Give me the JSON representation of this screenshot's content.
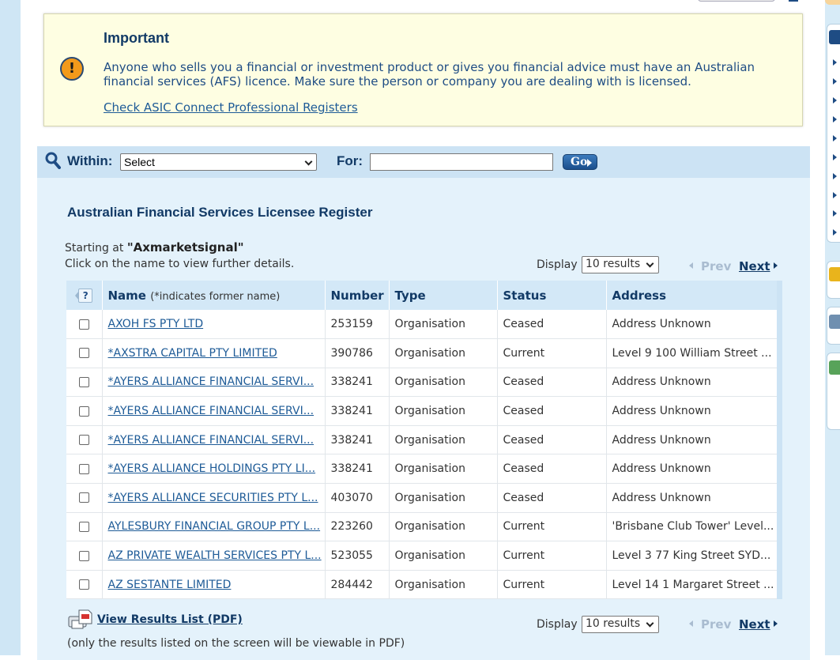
{
  "important": {
    "title": "Important",
    "icon": "exclamation-icon",
    "text": "Anyone who sells you a financial or investment product or gives you financial advice must have an Australian financial services (AFS) licence. Make sure the person or company you are dealing with is licensed.",
    "link": "Check ASIC Connect Professional Registers"
  },
  "search": {
    "within_label": "Within:",
    "within_value": "Select",
    "for_label": "For:",
    "for_value": "",
    "go_label": "Go"
  },
  "register": {
    "title": "Australian Financial Services Licensee Register",
    "starting_prefix": "Starting at ",
    "starting_value": "\"Axmarketsignal\"",
    "click_hint": "Click on the name to view further details."
  },
  "pagination": {
    "display_label": "Display",
    "display_value": "10 results",
    "prev": "Prev",
    "next": "Next"
  },
  "table": {
    "help": "?",
    "headers": {
      "name": "Name",
      "name_note": "(*indicates former name)",
      "number": "Number",
      "type": "Type",
      "status": "Status",
      "address": "Address"
    },
    "rows": [
      {
        "name": "AXOH FS PTY LTD",
        "number": "253159",
        "type": "Organisation",
        "status": "Ceased",
        "address": "Address Unknown"
      },
      {
        "name": "*AXSTRA CAPITAL PTY LIMITED",
        "number": "390786",
        "type": "Organisation",
        "status": "Current",
        "address": "Level 9 100 William Street ..."
      },
      {
        "name": "*AYERS ALLIANCE FINANCIAL SERVI...",
        "number": "338241",
        "type": "Organisation",
        "status": "Ceased",
        "address": "Address Unknown"
      },
      {
        "name": "*AYERS ALLIANCE FINANCIAL SERVI...",
        "number": "338241",
        "type": "Organisation",
        "status": "Ceased",
        "address": "Address Unknown"
      },
      {
        "name": "*AYERS ALLIANCE FINANCIAL SERVI...",
        "number": "338241",
        "type": "Organisation",
        "status": "Ceased",
        "address": "Address Unknown"
      },
      {
        "name": "*AYERS ALLIANCE HOLDINGS PTY LI...",
        "number": "338241",
        "type": "Organisation",
        "status": "Ceased",
        "address": "Address Unknown"
      },
      {
        "name": "*AYERS ALLIANCE SECURITIES PTY L...",
        "number": "403070",
        "type": "Organisation",
        "status": "Ceased",
        "address": "Address Unknown"
      },
      {
        "name": "AYLESBURY FINANCIAL GROUP PTY L...",
        "number": "223260",
        "type": "Organisation",
        "status": "Current",
        "address": "'Brisbane Club Tower' Level..."
      },
      {
        "name": "AZ PRIVATE WEALTH SERVICES PTY L...",
        "number": "523055",
        "type": "Organisation",
        "status": "Current",
        "address": "Level 3 77 King Street SYD..."
      },
      {
        "name": "AZ SESTANTE LIMITED",
        "number": "284442",
        "type": "Organisation",
        "status": "Current",
        "address": "Level 14 1 Margaret Street ..."
      }
    ]
  },
  "pdf": {
    "icon": "pdf-document-icon",
    "link": "View Results List (PDF)",
    "note": "(only the results listed on the screen will be viewable in PDF)"
  },
  "colors": {
    "accent": "#123a66",
    "link": "#1e5b97",
    "notice_bg": "#fefee2",
    "panel_bg": "#e4f2fb",
    "header_bg": "#d3e8f7",
    "warning": "#f39a1b"
  }
}
